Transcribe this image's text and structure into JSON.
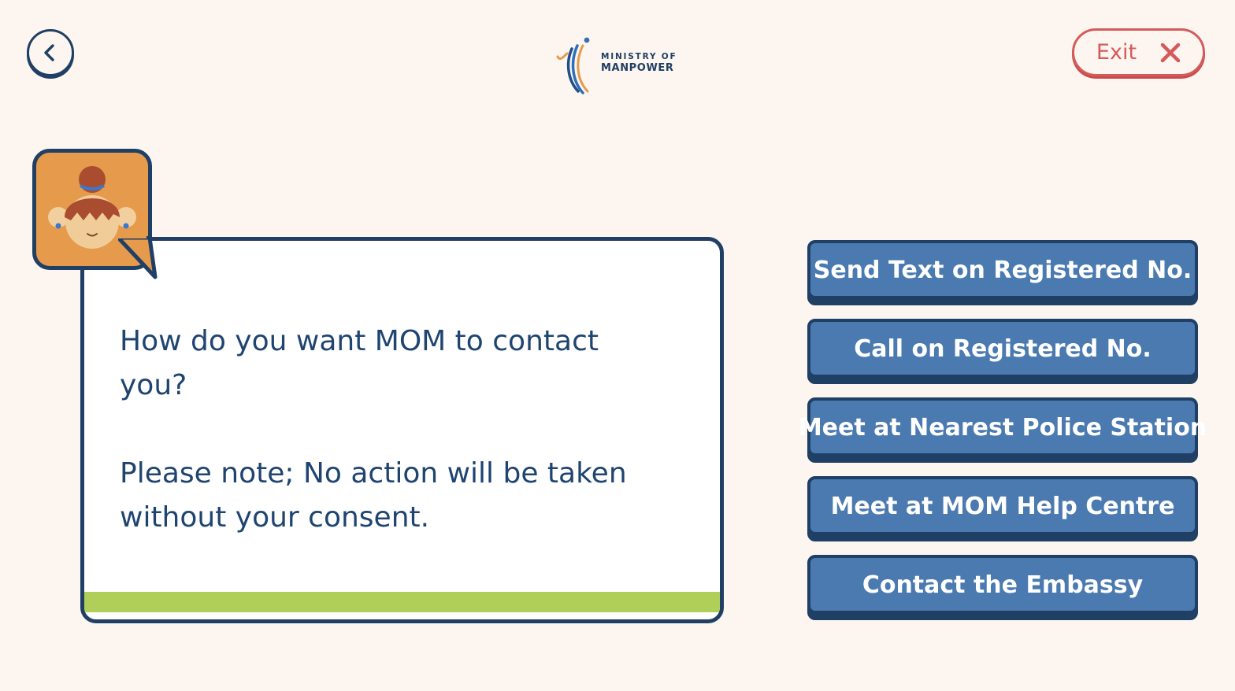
{
  "header": {
    "back_icon": "chevron-left-icon",
    "logo": {
      "line1": "MINISTRY OF",
      "line2": "MANPOWER"
    },
    "exit": {
      "label": "Exit",
      "icon": "close-icon"
    }
  },
  "message": {
    "question": "How do you want MOM to contact you?",
    "note": "Please note; No action will be taken without your consent."
  },
  "options": [
    "Send Text on Registered No.",
    "Call on Registered No.",
    "Meet at Nearest Police Station",
    "Meet at MOM Help Centre",
    "Contact the Embassy"
  ],
  "colors": {
    "background": "#fdf6f0",
    "navy": "#1f3f64",
    "button_blue": "#4a7ab0",
    "exit_red": "#d55b5b",
    "accent_green": "#b0cf58",
    "avatar_orange": "#e59a4c"
  }
}
